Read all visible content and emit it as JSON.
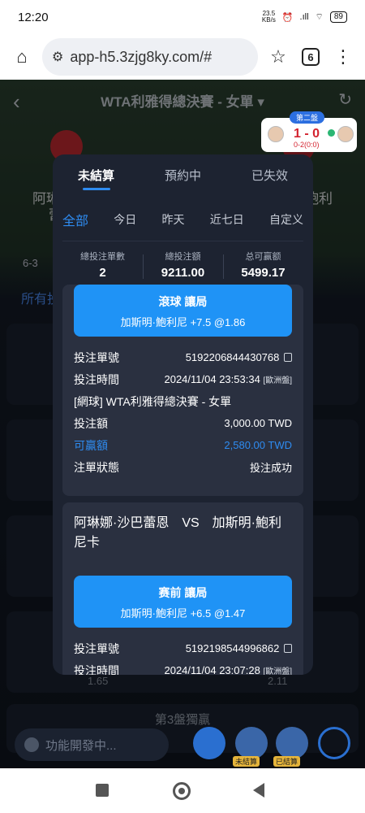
{
  "status_bar": {
    "time": "12:20",
    "net_speed": "23.5\nKB/s",
    "signal": ".ıll",
    "battery": "89"
  },
  "browser": {
    "url": "app-h5.3zjg8ky.com/#",
    "tab_count": "6"
  },
  "background": {
    "title": "WTA利雅得總決賽 - 女單 ▾",
    "team_left": "阿琳",
    "team_left_2": "蕾",
    "team_right": "鮑利",
    "set_score": "6-3",
    "all_label": "所有投",
    "third_set_label": "第3盤獨贏",
    "odds_left": "1.65",
    "odds_right": "2.11"
  },
  "score_widget": {
    "tag": "第二盤",
    "score": "1 - 0",
    "sub": "0-2(0:0)"
  },
  "modal": {
    "tabs": [
      "未結算",
      "預約中",
      "已失效"
    ],
    "filters": [
      "全部",
      "今日",
      "昨天",
      "近七日",
      "自定义"
    ],
    "stats": [
      {
        "label": "總投注單數",
        "value": "2"
      },
      {
        "label": "總投注額",
        "value": "9211.00"
      },
      {
        "label": "总可赢额",
        "value": "5499.17"
      }
    ],
    "bet1": {
      "type": "滾球 讓局",
      "selection": "加斯明·鮑利尼 +7.5 @1.86",
      "order_label": "投注單號",
      "order_no": "5192206844430768",
      "time_label": "投注時間",
      "time": "2024/11/04 23:53:34",
      "time_zone": "[歐洲盤]",
      "league": "[網球] WTA利雅得總決賽 - 女單",
      "amount_label": "投注額",
      "amount": "3,000.00 TWD",
      "win_label": "可贏額",
      "win": "2,580.00 TWD",
      "status_label": "注單狀態",
      "status": "投注成功"
    },
    "bet2": {
      "match": "阿琳娜·沙巴蕾恩　VS　加斯明·鮑利尼卡",
      "type": "赛前 讓局",
      "selection": "加斯明·鮑利尼 +6.5 @1.47",
      "order_label": "投注單號",
      "order_no": "5192198544996862",
      "time_label": "投注時間",
      "time": "2024/11/04 23:07:28",
      "time_zone": "[歐洲盤]"
    }
  },
  "toolbar": {
    "chat_placeholder": "功能開發中...",
    "unsettled_tag": "未結算",
    "settled_tag": "已結算"
  },
  "colors": {
    "accent": "#2e8bf0",
    "button": "#1f93f6",
    "modal_bg": "#1d2331",
    "score_red": "#d3232f"
  }
}
